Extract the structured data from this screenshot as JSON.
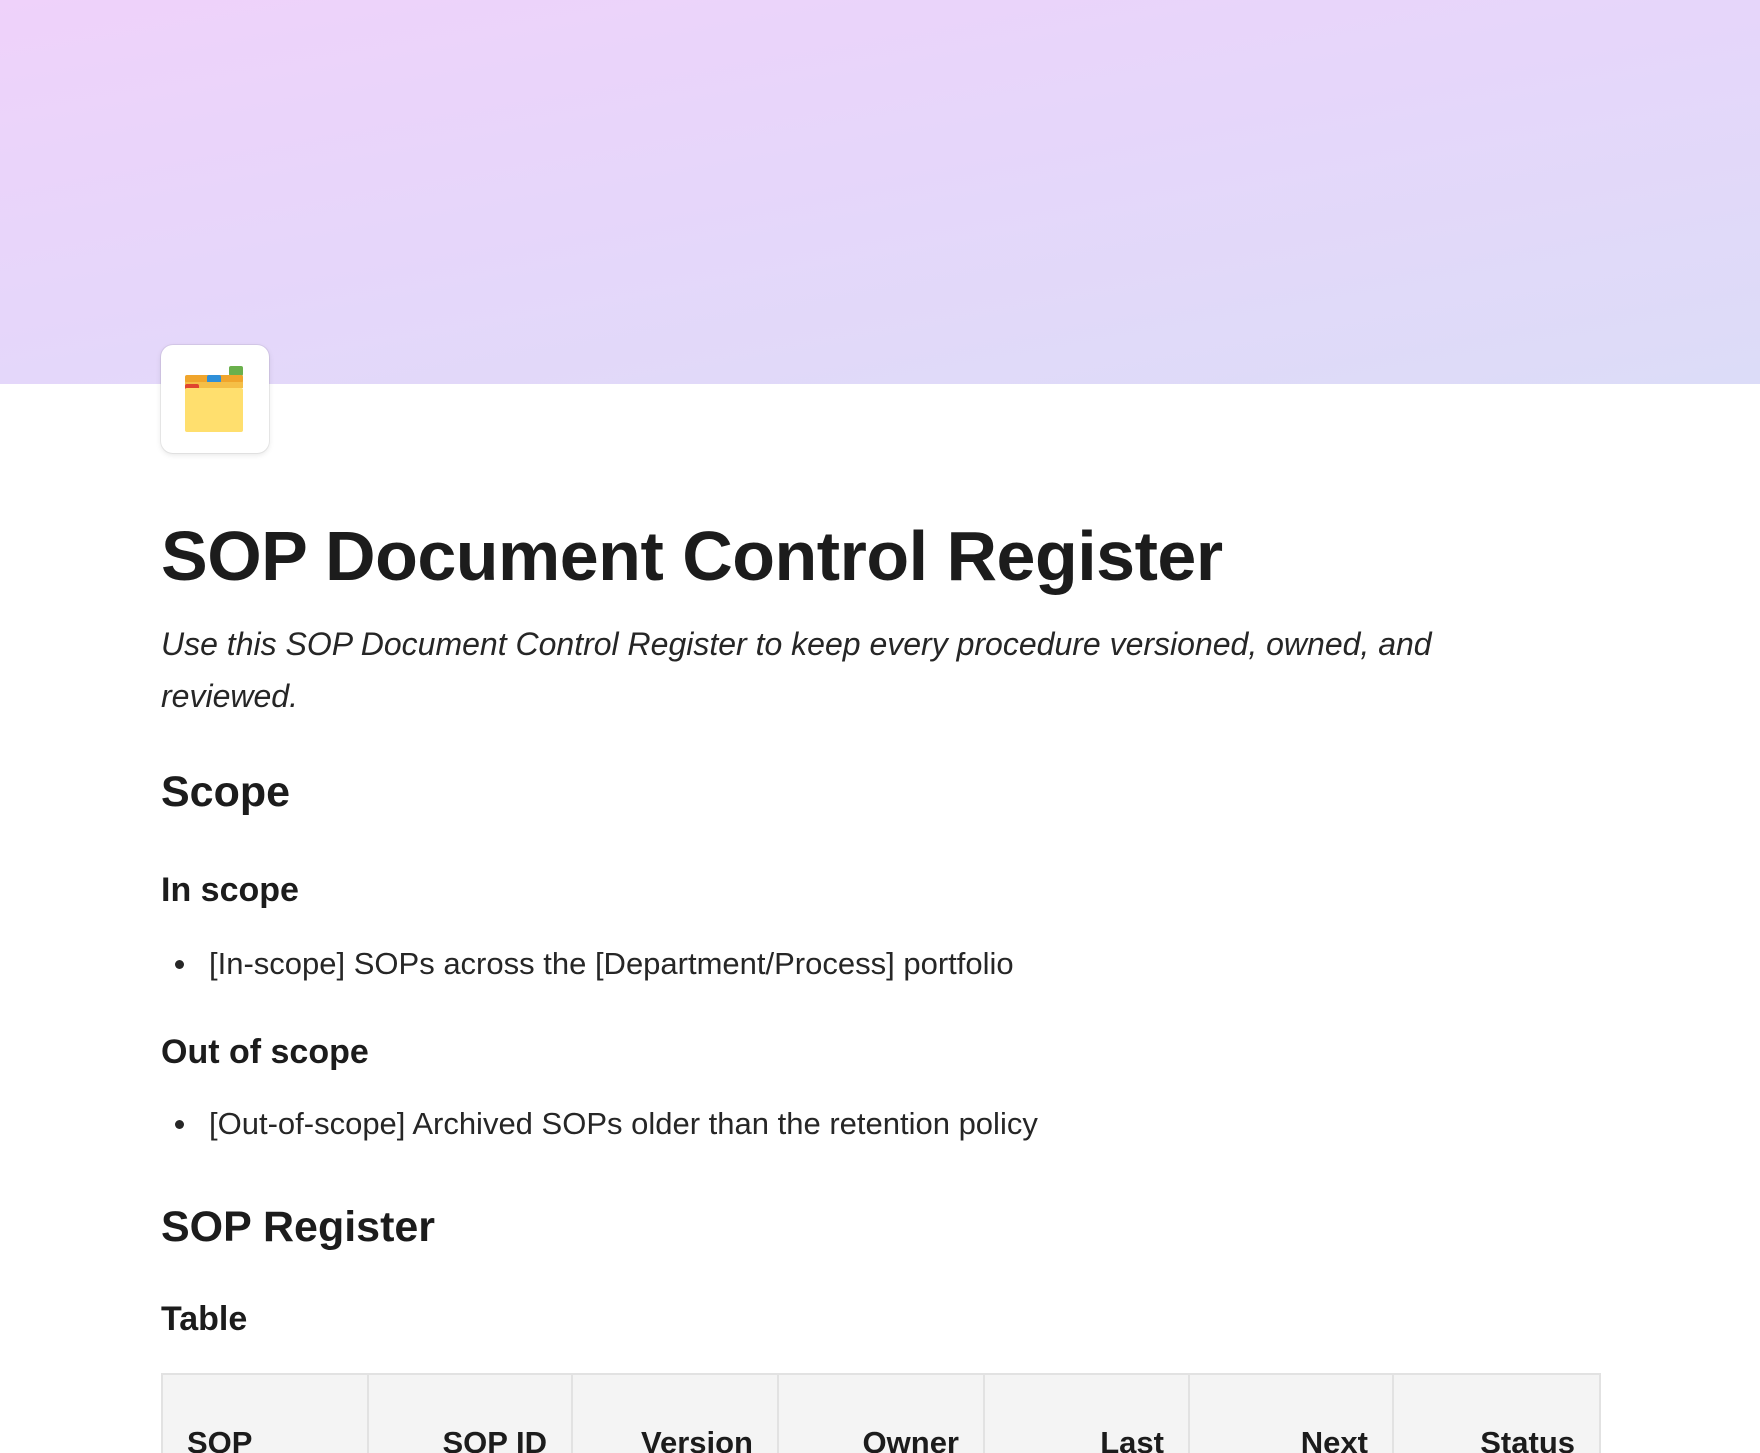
{
  "page": {
    "title": "SOP Document Control Register",
    "subtitle": "Use this SOP Document Control Register to keep every procedure versioned, owned, and reviewed.",
    "icon": "card-index-dividers-icon"
  },
  "sections": {
    "scope": {
      "heading": "Scope",
      "in_scope": {
        "heading": "In scope",
        "items": [
          "[In-scope] SOPs across the [Department/Process] portfolio"
        ]
      },
      "out_of_scope": {
        "heading": "Out of scope",
        "items": [
          "[Out-of-scope] Archived SOPs older than the retention policy"
        ]
      }
    },
    "register": {
      "heading": "SOP Register",
      "table_heading": "Table",
      "columns": [
        "SOP",
        "SOP ID",
        "Version",
        "Owner",
        "Last",
        "Next",
        "Status"
      ]
    }
  },
  "colors": {
    "cover_start": "#efd2fa",
    "cover_end": "#dcdcf8",
    "text": "#1c1c1c",
    "table_header_bg": "#f4f4f4"
  }
}
